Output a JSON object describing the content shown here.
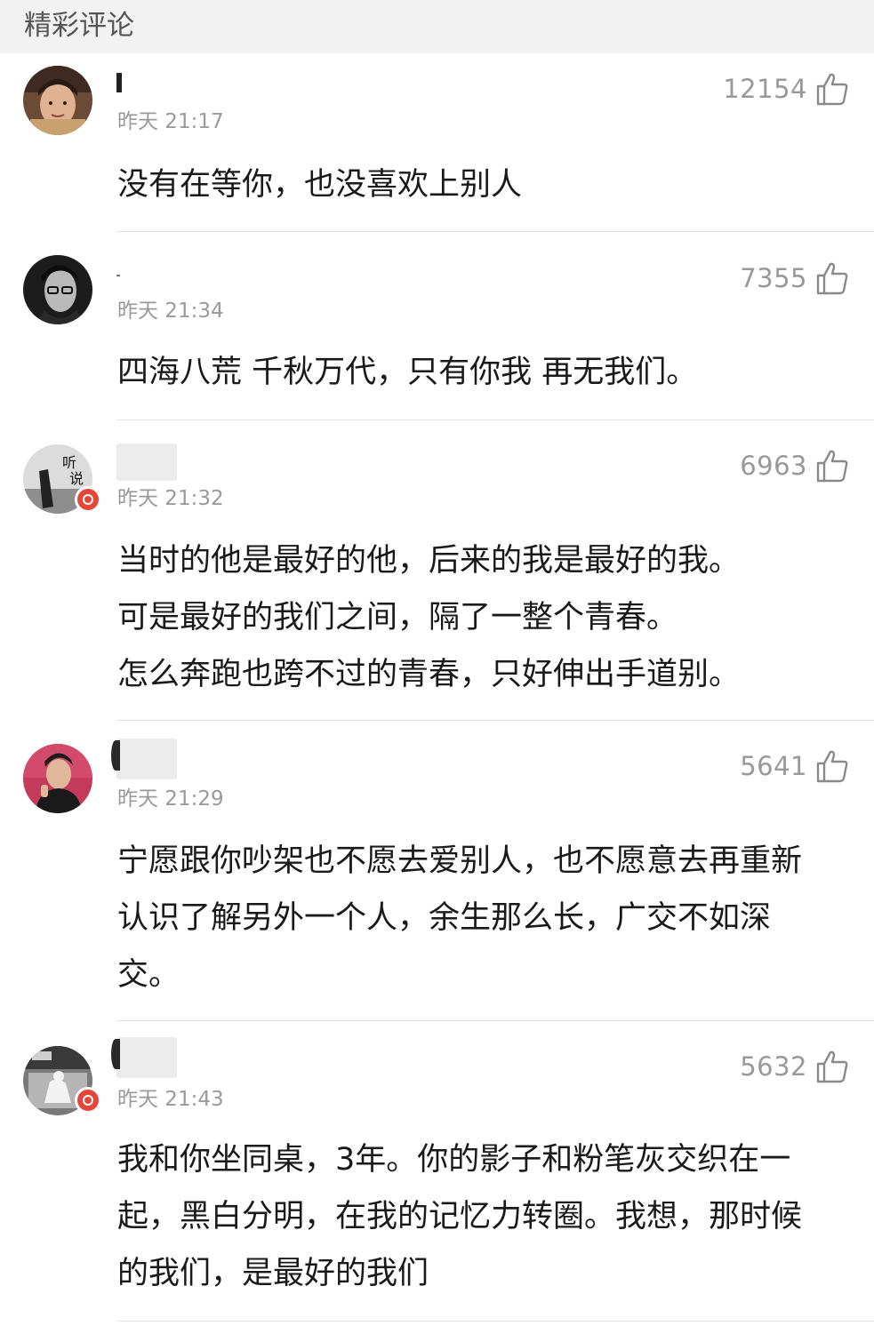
{
  "section": {
    "title": "精彩评论"
  },
  "comments": [
    {
      "timestamp": "昨天 21:17",
      "likes": "12154",
      "text": "没有在等你，也没喜欢上别人",
      "vip": false
    },
    {
      "timestamp": "昨天 21:34",
      "likes": "7355",
      "text": "四海八荒 千秋万代，只有你我 再无我们。",
      "vip": false
    },
    {
      "timestamp": "昨天 21:32",
      "likes": "6963",
      "text": "当时的他是最好的他，后来的我是最好的我。\n可是最好的我们之间，隔了一整个青春。\n怎么奔跑也跨不过的青春，只好伸出手道别。",
      "vip": true
    },
    {
      "timestamp": "昨天 21:29",
      "likes": "5641",
      "text": "宁愿跟你吵架也不愿去爱别人，也不愿意去再重新\n认识了解另外一个人，余生那么长，广交不如深\n交。",
      "vip": false
    },
    {
      "timestamp": "昨天 21:43",
      "likes": "5632",
      "text": "我和你坐同桌，3年。你的影子和粉笔灰交织在一\n起，黑白分明，在我的记忆力转圈。我想，那时候\n的我们，是最好的我们",
      "vip": true
    }
  ],
  "colors": {
    "header_bg": "#f2f2f2",
    "meta_gray": "#9a9a9a",
    "text": "#1a1a1a",
    "divider": "#e4e4e4",
    "vip_badge": "#e4463a"
  },
  "icons": {
    "like": "thumbs-up-icon",
    "vip": "vip-badge-icon"
  }
}
